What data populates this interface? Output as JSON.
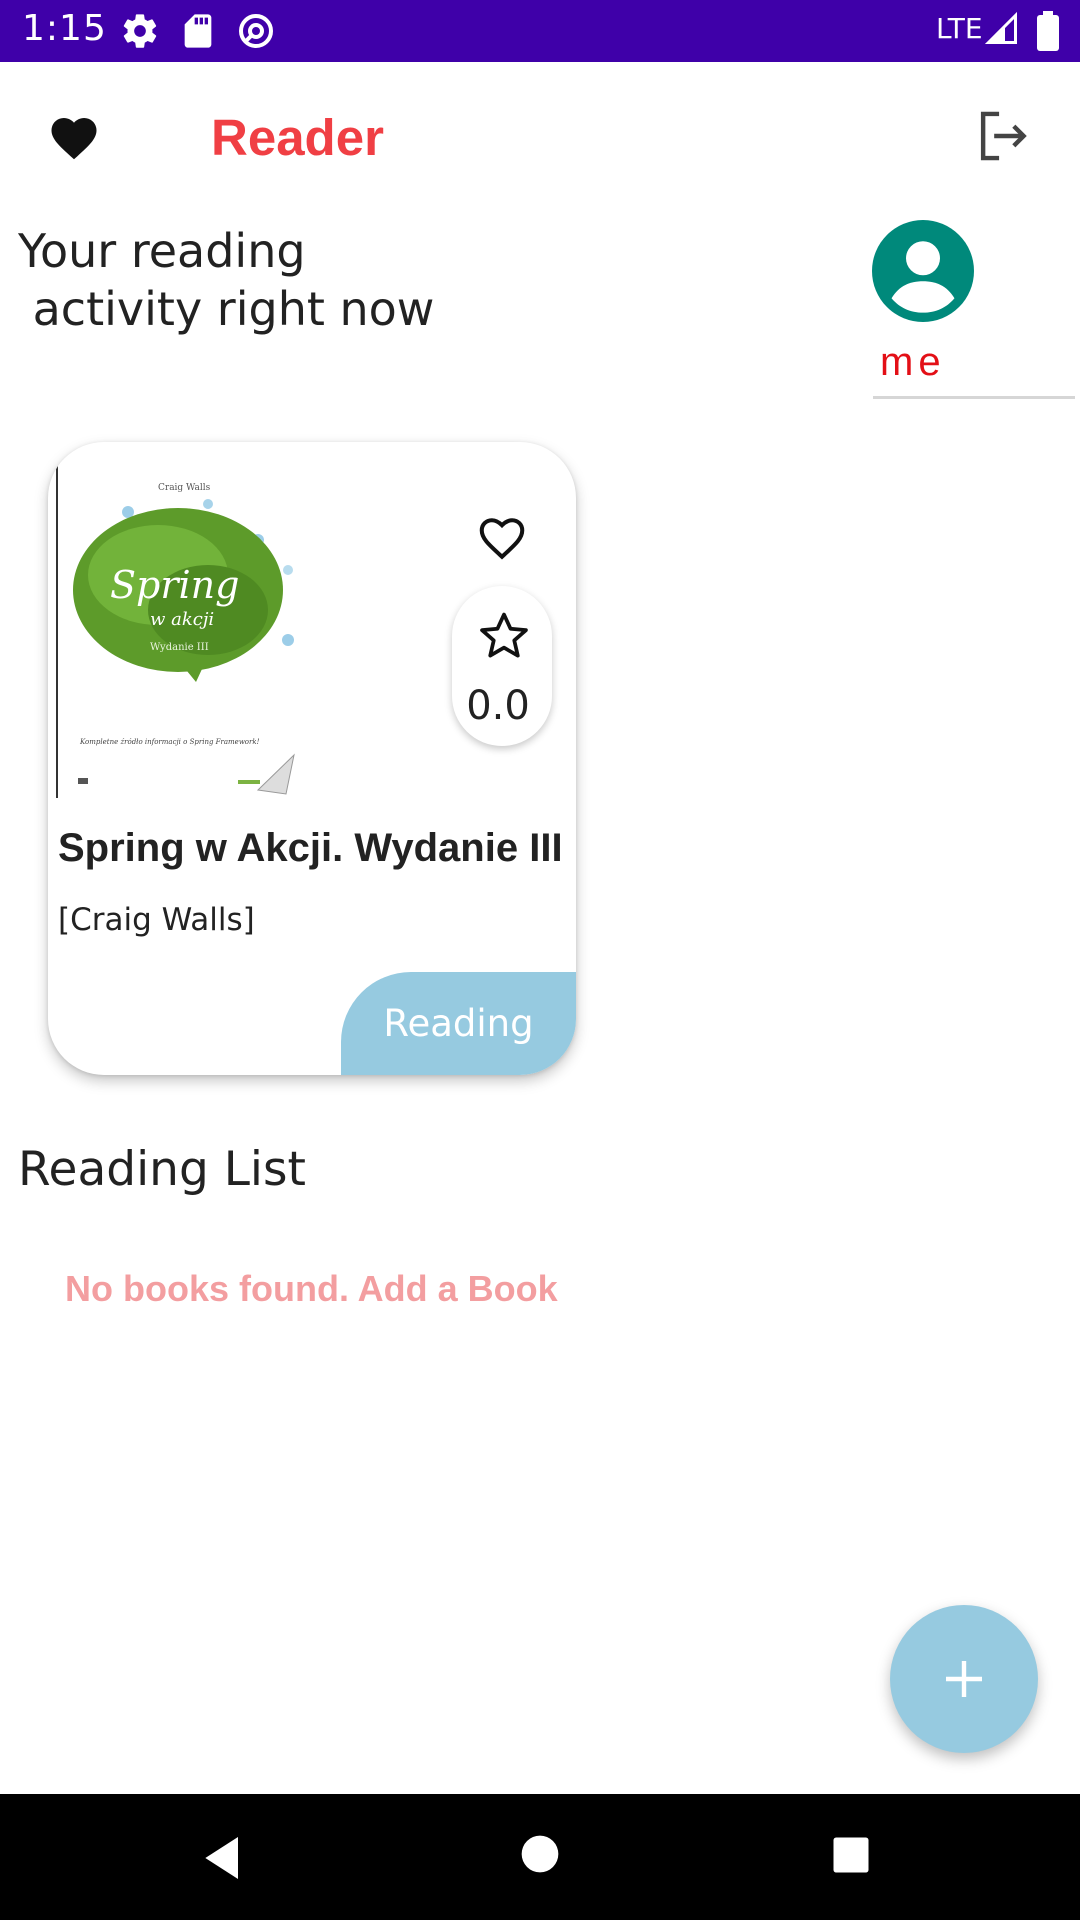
{
  "status_bar": {
    "time": "1:15",
    "network": "LTE",
    "icons": [
      "settings-icon",
      "sd-card-icon",
      "data-saver-icon",
      "signal-icon",
      "battery-icon"
    ]
  },
  "app_bar": {
    "title": "Reader",
    "left_icon": "favorite-filled-icon",
    "right_icon": "logout-icon"
  },
  "greeting": "Your reading\n activity right now",
  "user": {
    "name": "me",
    "avatar_icon": "account-circle-icon",
    "avatar_color": "#00897b"
  },
  "current_book": {
    "cover_text": {
      "author": "Craig Walls",
      "title": "Spring",
      "subtitle": "w akcji",
      "edition": "Wydanie III",
      "tagline": "Kompletne źródło informacji o Spring Framework!"
    },
    "title": "Spring w Akcji. Wydanie III",
    "authors": "[Craig Walls]",
    "rating": "0.0",
    "status": "Reading"
  },
  "reading_list": {
    "title": "Reading List",
    "empty_message": "No books found. Add a Book"
  },
  "fab": {
    "icon": "add-icon"
  },
  "colors": {
    "status_bar": "#3f00a9",
    "accent_red": "#f03f44",
    "badge_blue": "#96cae0",
    "empty_text": "#f39ea0"
  }
}
